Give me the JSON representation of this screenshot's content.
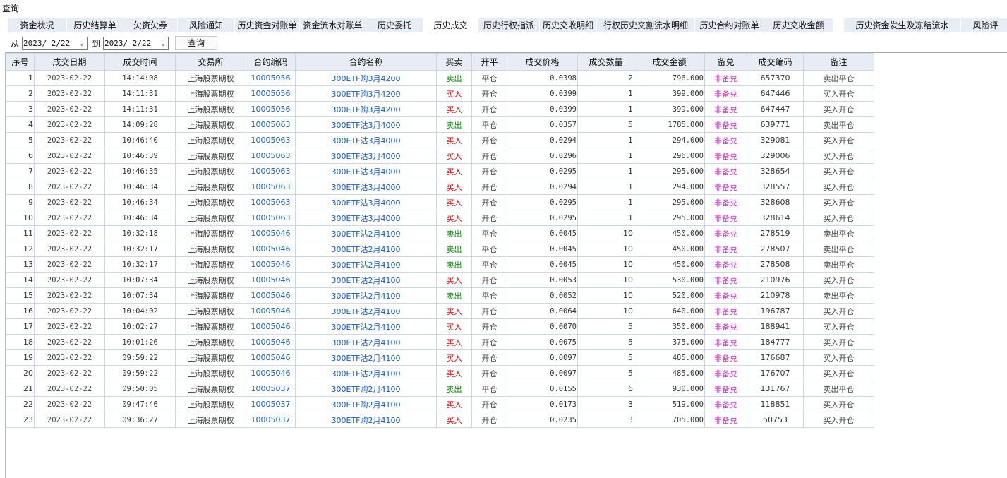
{
  "title": "查询",
  "tabs": [
    "资金状况",
    "历史结算单",
    "欠资欠券",
    "风险通知",
    "历史资金对账单",
    "资金流水对账单",
    "历史委托",
    "历史成交",
    "历史行权指派",
    "历史交收明细",
    "行权历史交割流水明细",
    "历史合约对账单",
    "历史交收金额",
    "历史资金发生及冻结流水",
    "风险评"
  ],
  "active_tab": "历史成交",
  "filter": {
    "from_label": "从",
    "from": "2023/ 2/22",
    "to_label": "到",
    "to": "2023/ 2/22",
    "query": "查询"
  },
  "colors": {
    "buy": "#e00000",
    "sell": "#008a00",
    "code": "#1a5bb5",
    "covered": "#c03cc0"
  },
  "columns": [
    "序号",
    "成交日期",
    "成交时间",
    "交易所",
    "合约编码",
    "合约名称",
    "买卖",
    "开平",
    "成交价格",
    "成交数量",
    "成交金额",
    "备兑",
    "成交编码",
    "备注"
  ],
  "rows": [
    [
      "1",
      "2023-02-22",
      "14:14:08",
      "上海股票期权",
      "10005056",
      "300ETF购3月4200",
      "卖出",
      "平仓",
      "0.0398",
      "2",
      "796.000",
      "非备兑",
      "657370",
      "卖出平仓"
    ],
    [
      "2",
      "2023-02-22",
      "14:11:31",
      "上海股票期权",
      "10005056",
      "300ETF购3月4200",
      "买入",
      "开仓",
      "0.0399",
      "1",
      "399.000",
      "非备兑",
      "647446",
      "买入开仓"
    ],
    [
      "3",
      "2023-02-22",
      "14:11:31",
      "上海股票期权",
      "10005056",
      "300ETF购3月4200",
      "买入",
      "开仓",
      "0.0399",
      "1",
      "399.000",
      "非备兑",
      "647447",
      "买入开仓"
    ],
    [
      "4",
      "2023-02-22",
      "14:09:28",
      "上海股票期权",
      "10005063",
      "300ETF沽3月4000",
      "卖出",
      "平仓",
      "0.0357",
      "5",
      "1785.000",
      "非备兑",
      "639771",
      "卖出平仓"
    ],
    [
      "5",
      "2023-02-22",
      "10:46:40",
      "上海股票期权",
      "10005063",
      "300ETF沽3月4000",
      "买入",
      "开仓",
      "0.0294",
      "1",
      "294.000",
      "非备兑",
      "329081",
      "买入开仓"
    ],
    [
      "6",
      "2023-02-22",
      "10:46:39",
      "上海股票期权",
      "10005063",
      "300ETF沽3月4000",
      "买入",
      "开仓",
      "0.0296",
      "1",
      "296.000",
      "非备兑",
      "329006",
      "买入开仓"
    ],
    [
      "7",
      "2023-02-22",
      "10:46:35",
      "上海股票期权",
      "10005063",
      "300ETF沽3月4000",
      "买入",
      "开仓",
      "0.0295",
      "1",
      "295.000",
      "非备兑",
      "328654",
      "买入开仓"
    ],
    [
      "8",
      "2023-02-22",
      "10:46:34",
      "上海股票期权",
      "10005063",
      "300ETF沽3月4000",
      "买入",
      "开仓",
      "0.0294",
      "1",
      "294.000",
      "非备兑",
      "328557",
      "买入开仓"
    ],
    [
      "9",
      "2023-02-22",
      "10:46:34",
      "上海股票期权",
      "10005063",
      "300ETF沽3月4000",
      "买入",
      "开仓",
      "0.0295",
      "1",
      "295.000",
      "非备兑",
      "328608",
      "买入开仓"
    ],
    [
      "10",
      "2023-02-22",
      "10:46:34",
      "上海股票期权",
      "10005063",
      "300ETF沽3月4000",
      "买入",
      "开仓",
      "0.0295",
      "1",
      "295.000",
      "非备兑",
      "328614",
      "买入开仓"
    ],
    [
      "11",
      "2023-02-22",
      "10:32:18",
      "上海股票期权",
      "10005046",
      "300ETF沽2月4100",
      "卖出",
      "平仓",
      "0.0045",
      "10",
      "450.000",
      "非备兑",
      "278519",
      "卖出平仓"
    ],
    [
      "12",
      "2023-02-22",
      "10:32:17",
      "上海股票期权",
      "10005046",
      "300ETF沽2月4100",
      "卖出",
      "平仓",
      "0.0045",
      "10",
      "450.000",
      "非备兑",
      "278507",
      "卖出平仓"
    ],
    [
      "13",
      "2023-02-22",
      "10:32:17",
      "上海股票期权",
      "10005046",
      "300ETF沽2月4100",
      "卖出",
      "平仓",
      "0.0045",
      "10",
      "450.000",
      "非备兑",
      "278508",
      "卖出平仓"
    ],
    [
      "14",
      "2023-02-22",
      "10:07:34",
      "上海股票期权",
      "10005046",
      "300ETF沽2月4100",
      "买入",
      "开仓",
      "0.0053",
      "10",
      "530.000",
      "非备兑",
      "210976",
      "买入开仓"
    ],
    [
      "15",
      "2023-02-22",
      "10:07:34",
      "上海股票期权",
      "10005046",
      "300ETF沽2月4100",
      "卖出",
      "平仓",
      "0.0052",
      "10",
      "520.000",
      "非备兑",
      "210978",
      "卖出平仓"
    ],
    [
      "16",
      "2023-02-22",
      "10:04:02",
      "上海股票期权",
      "10005046",
      "300ETF沽2月4100",
      "买入",
      "开仓",
      "0.0064",
      "10",
      "640.000",
      "非备兑",
      "196787",
      "买入开仓"
    ],
    [
      "17",
      "2023-02-22",
      "10:02:27",
      "上海股票期权",
      "10005046",
      "300ETF沽2月4100",
      "买入",
      "开仓",
      "0.0070",
      "5",
      "350.000",
      "非备兑",
      "188941",
      "买入开仓"
    ],
    [
      "18",
      "2023-02-22",
      "10:01:26",
      "上海股票期权",
      "10005046",
      "300ETF沽2月4100",
      "买入",
      "开仓",
      "0.0075",
      "5",
      "375.000",
      "非备兑",
      "184777",
      "买入开仓"
    ],
    [
      "19",
      "2023-02-22",
      "09:59:22",
      "上海股票期权",
      "10005046",
      "300ETF沽2月4100",
      "买入",
      "开仓",
      "0.0097",
      "5",
      "485.000",
      "非备兑",
      "176687",
      "买入开仓"
    ],
    [
      "20",
      "2023-02-22",
      "09:59:22",
      "上海股票期权",
      "10005046",
      "300ETF沽2月4100",
      "买入",
      "开仓",
      "0.0097",
      "5",
      "485.000",
      "非备兑",
      "176707",
      "买入开仓"
    ],
    [
      "21",
      "2023-02-22",
      "09:50:05",
      "上海股票期权",
      "10005037",
      "300ETF购2月4100",
      "卖出",
      "平仓",
      "0.0155",
      "6",
      "930.000",
      "非备兑",
      "131767",
      "卖出平仓"
    ],
    [
      "22",
      "2023-02-22",
      "09:47:46",
      "上海股票期权",
      "10005037",
      "300ETF购2月4100",
      "买入",
      "开仓",
      "0.0173",
      "3",
      "519.000",
      "非备兑",
      "118851",
      "买入开仓"
    ],
    [
      "23",
      "2023-02-22",
      "09:36:27",
      "上海股票期权",
      "10005037",
      "300ETF购2月4100",
      "买入",
      "开仓",
      "0.0235",
      "3",
      "705.000",
      "非备兑",
      "50753",
      "买入开仓"
    ]
  ]
}
